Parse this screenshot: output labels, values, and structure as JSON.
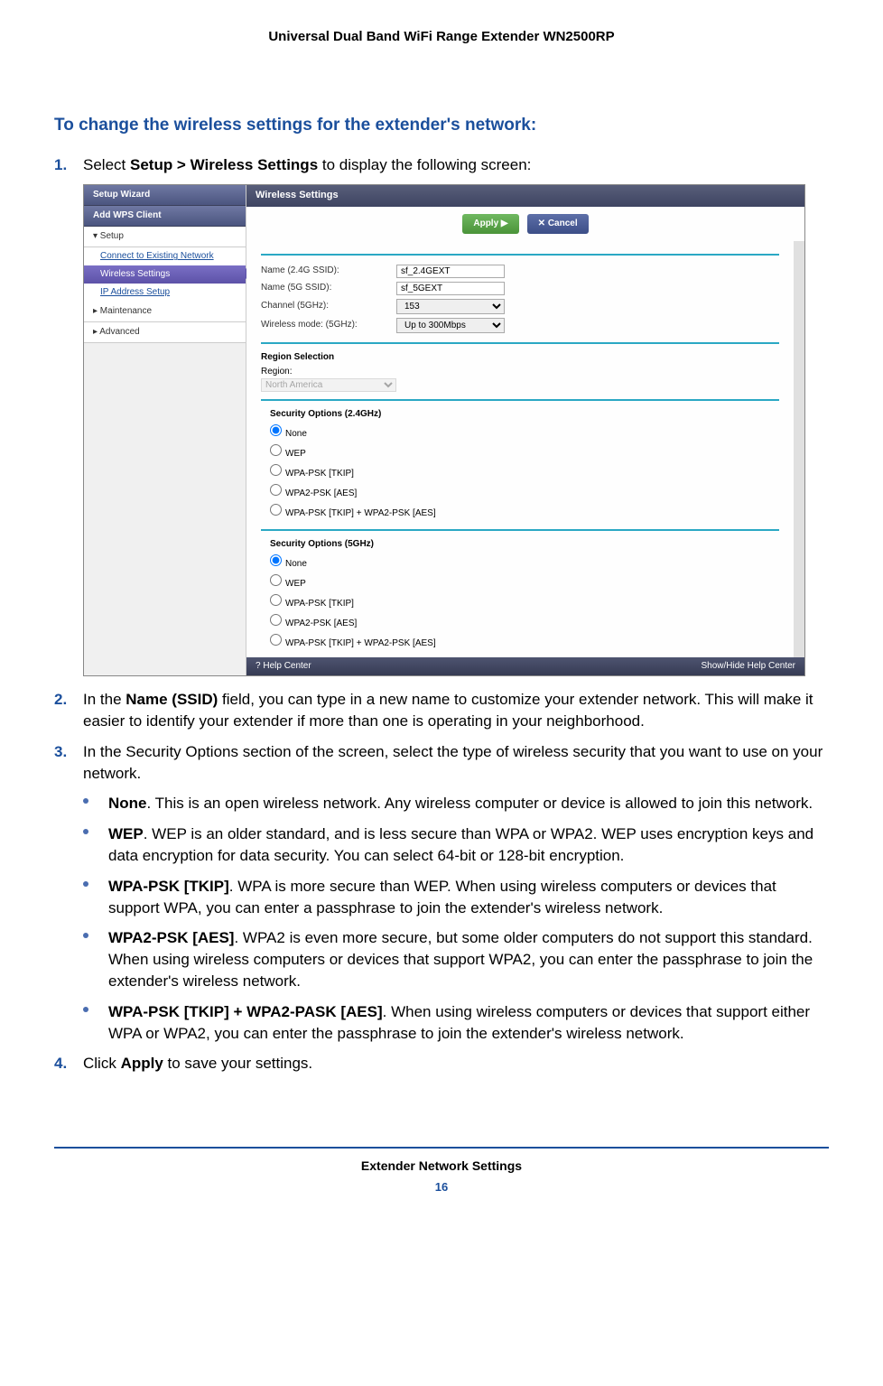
{
  "doc": {
    "header": "Universal Dual Band WiFi Range Extender WN2500RP",
    "footer_title": "Extender Network Settings",
    "page_number": "16",
    "section_heading": "To change the wireless settings for the extender's network:"
  },
  "steps": {
    "s1_num": "1.",
    "s1_a": "Select ",
    "s1_b": "Setup > Wireless Settings",
    "s1_c": " to display the following screen:",
    "s2_num": "2.",
    "s2_a": "In the ",
    "s2_b": "Name (SSID)",
    "s2_c": " field, you can type in a new name to customize your extender network. This will make it easier to identify your extender if more than one is operating in your neighborhood.",
    "s3_num": "3.",
    "s3_text": "In the Security Options section of the screen, select the type of wireless security that you want to use on your network.",
    "b1_bold": "None",
    "b1_text": ". This is an open wireless network. Any wireless computer or device is allowed to join this network.",
    "b2_bold": "WEP",
    "b2_text": ". WEP is an older standard, and is less secure than WPA or WPA2. WEP uses encryption keys and data encryption for data security. You can select 64-bit or 128-bit encryption.",
    "b3_bold": "WPA-PSK [TKIP]",
    "b3_text": ". WPA is more secure than WEP. When using wireless computers or devices that support WPA, you can enter a passphrase to join the extender's wireless network.",
    "b4_bold": "WPA2-PSK [AES]",
    "b4_text": ". WPA2 is even more secure, but some older computers do not support this standard. When using wireless computers or devices that support WPA2, you can enter the passphrase to join the extender's wireless network.",
    "b5_bold": "WPA-PSK [TKIP] + WPA2-PASK [AES]",
    "b5_text": ". When using wireless computers or devices that support either WPA or WPA2, you can enter the passphrase to join the extender's wireless network.",
    "s4_num": "4.",
    "s4_a": "Click ",
    "s4_b": "Apply",
    "s4_c": " to save your settings."
  },
  "ui": {
    "nav": {
      "wizard": "Setup Wizard",
      "wps": "Add WPS Client",
      "setup": "▾ Setup",
      "connect": "Connect to Existing Network",
      "wireless": "Wireless Settings",
      "ip": "IP Address Setup",
      "maint": "▸ Maintenance",
      "adv": "▸ Advanced"
    },
    "header": "Wireless Settings",
    "apply": "Apply ▶",
    "cancel": "✕ Cancel",
    "fields": {
      "name24_label": "Name (2.4G SSID):",
      "name24_value": "sf_2.4GEXT",
      "name5_label": "Name (5G SSID):",
      "name5_value": "sf_5GEXT",
      "channel_label": "Channel (5GHz):",
      "channel_value": "153",
      "mode_label": "Wireless mode: (5GHz):",
      "mode_value": "Up to 300Mbps"
    },
    "region": {
      "heading": "Region Selection",
      "label": "Region:",
      "value": "North America"
    },
    "sec24": {
      "heading": "Security Options (2.4GHz)",
      "opts": [
        "None",
        "WEP",
        "WPA-PSK [TKIP]",
        "WPA2-PSK [AES]",
        "WPA-PSK [TKIP] + WPA2-PSK [AES]"
      ]
    },
    "sec5": {
      "heading": "Security Options (5GHz)",
      "opts": [
        "None",
        "WEP",
        "WPA-PSK [TKIP]",
        "WPA2-PSK [AES]",
        "WPA-PSK [TKIP] + WPA2-PSK [AES]"
      ]
    },
    "help": "Help Center",
    "showhide": "Show/Hide Help Center",
    "help_icon": "?"
  }
}
